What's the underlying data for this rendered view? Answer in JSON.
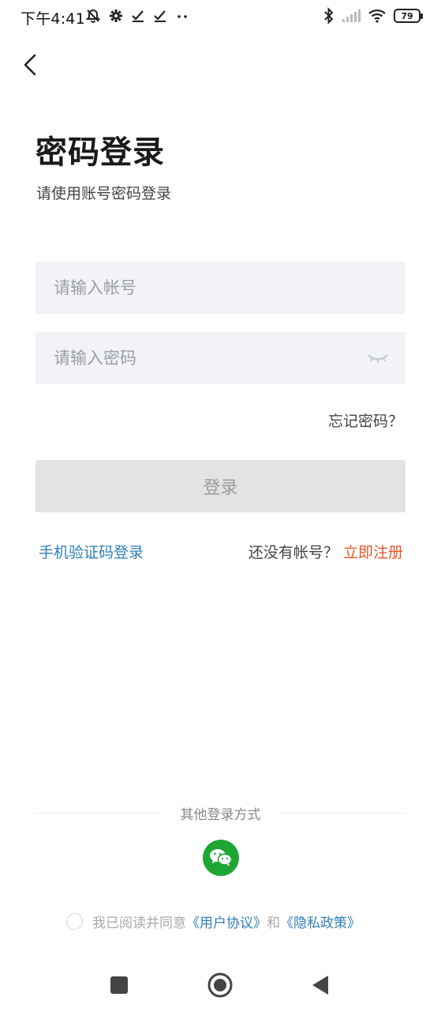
{
  "status_bar": {
    "time": "下午4:41",
    "left_icons": [
      "mute-alarm-icon",
      "settings-icon",
      "check-icon",
      "check-icon",
      "more-dots-icon"
    ],
    "right_icons": [
      "bluetooth-icon",
      "cellular-signal-icon",
      "wifi-icon"
    ],
    "battery_level": "79"
  },
  "header": {
    "back_icon": "chevron-left-icon"
  },
  "title": "密码登录",
  "subtitle": "请使用账号密码登录",
  "form": {
    "account_placeholder": "请输入帐号",
    "account_value": "",
    "password_placeholder": "请输入密码",
    "password_value": "",
    "password_toggle_icon": "eye-closed-icon",
    "forgot_label": "忘记密码？",
    "login_label": "登录"
  },
  "links": {
    "sms_login": "手机验证码登录",
    "no_account": "还没有帐号？",
    "register": "立即注册"
  },
  "other_login": {
    "label": "其他登录方式",
    "wechat_icon": "wechat-icon",
    "wechat_color": "#1ea534"
  },
  "agreement": {
    "prefix": "我已阅读并同意",
    "user_agreement": "《用户协议》",
    "and": "和",
    "privacy_policy": "《隐私政策》"
  },
  "nav_bar": {
    "recents_icon": "square-icon",
    "home_icon": "circle-icon",
    "back_icon": "triangle-back-icon"
  },
  "colors": {
    "link_blue": "#2f7fb8",
    "register_orange": "#e8562a",
    "button_disabled": "#e3e3e3",
    "input_bg": "#f2f3f7"
  }
}
